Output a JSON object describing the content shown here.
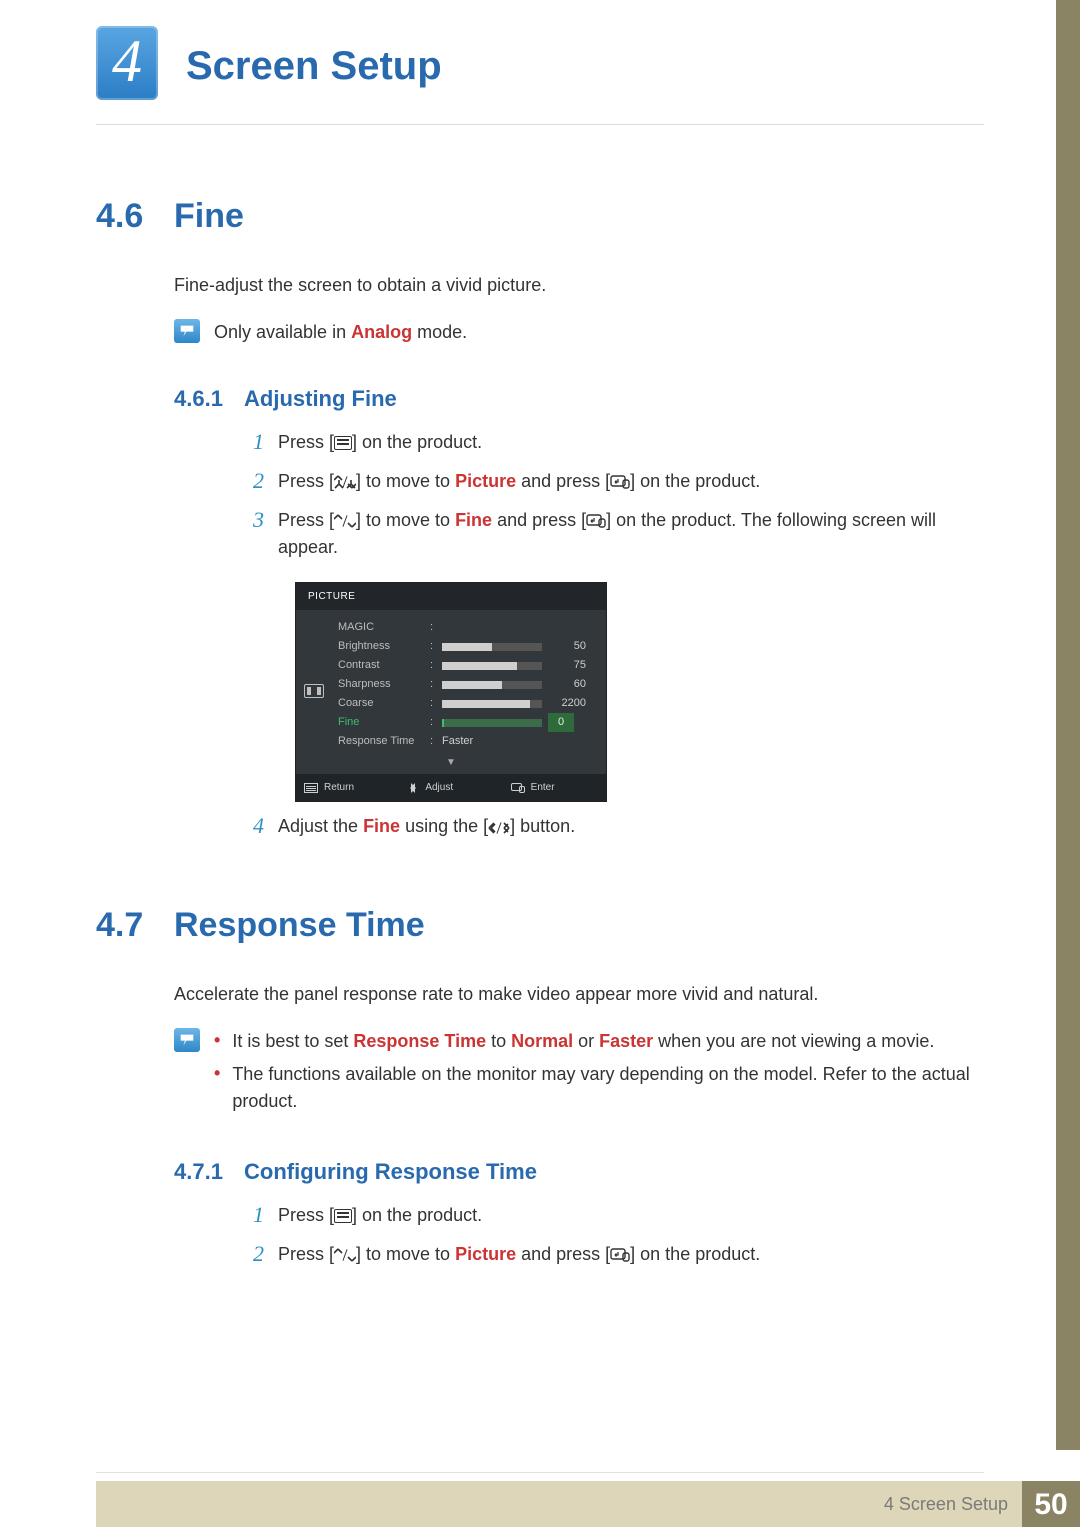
{
  "header": {
    "chapter_number": "4",
    "chapter_title": "Screen Setup"
  },
  "section_46": {
    "num": "4.6",
    "title": "Fine",
    "intro": "Fine-adjust the screen to obtain a vivid picture.",
    "note_prefix": "Only available in ",
    "note_kw": "Analog",
    "note_suffix": " mode.",
    "sub_num": "4.6.1",
    "sub_title": "Adjusting Fine",
    "step1_a": "Press [",
    "step1_b": "] on the product.",
    "step2_a": "Press [",
    "step2_b": "] to move to ",
    "step2_kw": "Picture",
    "step2_c": " and press [",
    "step2_d": "] on the product.",
    "step3_a": "Press [",
    "step3_b": "] to move to ",
    "step3_kw": "Fine",
    "step3_c": " and press [",
    "step3_d": "] on the product. The following screen will appear.",
    "step4_a": "Adjust the ",
    "step4_kw": "Fine",
    "step4_b": " using the [",
    "step4_c": "] button."
  },
  "osd": {
    "title": "PICTURE",
    "rows": [
      {
        "label": "MAGIC",
        "type": "blank"
      },
      {
        "label": "Brightness",
        "type": "bar",
        "value": 50,
        "max": 100
      },
      {
        "label": "Contrast",
        "type": "bar",
        "value": 75,
        "max": 100
      },
      {
        "label": "Sharpness",
        "type": "bar",
        "value": 60,
        "max": 100
      },
      {
        "label": "Coarse",
        "type": "bar",
        "value": 2200,
        "max": 2500
      },
      {
        "label": "Fine",
        "type": "bar",
        "value": 0,
        "max": 100,
        "highlight": true
      },
      {
        "label": "Response Time",
        "type": "text",
        "text": "Faster"
      }
    ],
    "foot_return": "Return",
    "foot_adjust": "Adjust",
    "foot_enter": "Enter"
  },
  "section_47": {
    "num": "4.7",
    "title": "Response Time",
    "intro": "Accelerate the panel response rate to make video appear more vivid and natural.",
    "bul1_a": "It is best to set ",
    "bul1_kw1": "Response Time",
    "bul1_b": " to ",
    "bul1_kw2": "Normal",
    "bul1_c": " or ",
    "bul1_kw3": "Faster",
    "bul1_d": " when you are not viewing a movie.",
    "bul2": "The functions available on the monitor may vary depending on the model. Refer to the actual product.",
    "sub_num": "4.7.1",
    "sub_title": "Configuring Response Time",
    "step1_a": "Press [",
    "step1_b": "] on the product.",
    "step2_a": "Press [",
    "step2_b": "] to move to ",
    "step2_kw": "Picture",
    "step2_c": " and press [",
    "step2_d": "] on the product."
  },
  "footer": {
    "label": "4 Screen Setup",
    "page": "50"
  },
  "step_nums": {
    "n1": "1",
    "n2": "2",
    "n3": "3",
    "n4": "4"
  }
}
